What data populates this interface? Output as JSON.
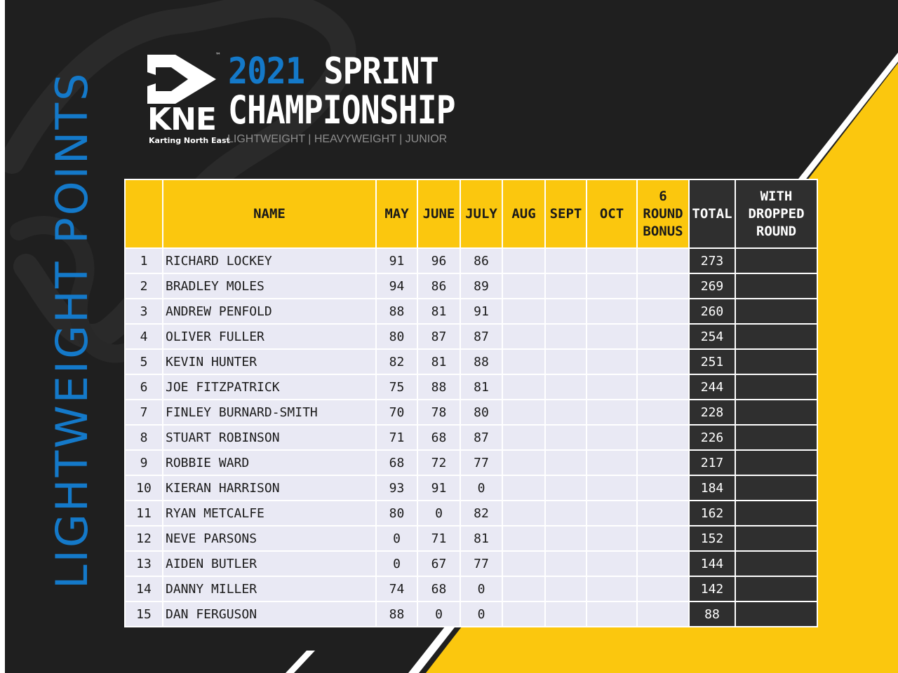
{
  "side_title": "LIGHTWEIGHT POINTS",
  "logo": {
    "mark_text": "KNE",
    "subtitle": "Karting North East",
    "tm": "™"
  },
  "title": {
    "year": "2021",
    "sprint": "SPRINT",
    "championship": "CHAMPIONSHIP",
    "classes": "LIGHTWEIGHT | HEAVYWEIGHT | JUNIOR"
  },
  "colors": {
    "accent_yellow": "#fbc70e",
    "accent_blue": "#1479c9",
    "background": "#1f1f1f",
    "dark_cell": "#2f2f2f",
    "row_bg": "#e9e9f4"
  },
  "table": {
    "headers": {
      "pos": "",
      "name": "NAME",
      "may": "MAY",
      "june": "JUNE",
      "july": "JULY",
      "aug": "AUG",
      "sept": "SEPT",
      "oct": "OCT",
      "bonus": "6 ROUND BONUS",
      "total": "TOTAL",
      "dropped": "WITH DROPPED ROUND"
    },
    "rows": [
      {
        "pos": "1",
        "name": "RICHARD LOCKEY",
        "may": "91",
        "june": "96",
        "july": "86",
        "aug": "",
        "sept": "",
        "oct": "",
        "bonus": "",
        "total": "273",
        "dropped": ""
      },
      {
        "pos": "2",
        "name": "BRADLEY MOLES",
        "may": "94",
        "june": "86",
        "july": "89",
        "aug": "",
        "sept": "",
        "oct": "",
        "bonus": "",
        "total": "269",
        "dropped": ""
      },
      {
        "pos": "3",
        "name": "ANDREW PENFOLD",
        "may": "88",
        "june": "81",
        "july": "91",
        "aug": "",
        "sept": "",
        "oct": "",
        "bonus": "",
        "total": "260",
        "dropped": ""
      },
      {
        "pos": "4",
        "name": "OLIVER FULLER",
        "may": "80",
        "june": "87",
        "july": "87",
        "aug": "",
        "sept": "",
        "oct": "",
        "bonus": "",
        "total": "254",
        "dropped": ""
      },
      {
        "pos": "5",
        "name": "KEVIN HUNTER",
        "may": "82",
        "june": "81",
        "july": "88",
        "aug": "",
        "sept": "",
        "oct": "",
        "bonus": "",
        "total": "251",
        "dropped": ""
      },
      {
        "pos": "6",
        "name": "JOE FITZPATRICK",
        "may": "75",
        "june": "88",
        "july": "81",
        "aug": "",
        "sept": "",
        "oct": "",
        "bonus": "",
        "total": "244",
        "dropped": ""
      },
      {
        "pos": "7",
        "name": "FINLEY BURNARD-SMITH",
        "may": "70",
        "june": "78",
        "july": "80",
        "aug": "",
        "sept": "",
        "oct": "",
        "bonus": "",
        "total": "228",
        "dropped": ""
      },
      {
        "pos": "8",
        "name": "STUART ROBINSON",
        "may": "71",
        "june": "68",
        "july": "87",
        "aug": "",
        "sept": "",
        "oct": "",
        "bonus": "",
        "total": "226",
        "dropped": ""
      },
      {
        "pos": "9",
        "name": "ROBBIE WARD",
        "may": "68",
        "june": "72",
        "july": "77",
        "aug": "",
        "sept": "",
        "oct": "",
        "bonus": "",
        "total": "217",
        "dropped": ""
      },
      {
        "pos": "10",
        "name": "KIERAN HARRISON",
        "may": "93",
        "june": "91",
        "july": "0",
        "aug": "",
        "sept": "",
        "oct": "",
        "bonus": "",
        "total": "184",
        "dropped": ""
      },
      {
        "pos": "11",
        "name": "RYAN METCALFE",
        "may": "80",
        "june": "0",
        "july": "82",
        "aug": "",
        "sept": "",
        "oct": "",
        "bonus": "",
        "total": "162",
        "dropped": ""
      },
      {
        "pos": "12",
        "name": "NEVE PARSONS",
        "may": "0",
        "june": "71",
        "july": "81",
        "aug": "",
        "sept": "",
        "oct": "",
        "bonus": "",
        "total": "152",
        "dropped": ""
      },
      {
        "pos": "13",
        "name": "AIDEN BUTLER",
        "may": "0",
        "june": "67",
        "july": "77",
        "aug": "",
        "sept": "",
        "oct": "",
        "bonus": "",
        "total": "144",
        "dropped": ""
      },
      {
        "pos": "14",
        "name": "DANNY MILLER",
        "may": "74",
        "june": "68",
        "july": "0",
        "aug": "",
        "sept": "",
        "oct": "",
        "bonus": "",
        "total": "142",
        "dropped": ""
      },
      {
        "pos": "15",
        "name": "DAN FERGUSON",
        "may": "88",
        "june": "0",
        "july": "0",
        "aug": "",
        "sept": "",
        "oct": "",
        "bonus": "",
        "total": "88",
        "dropped": ""
      }
    ]
  }
}
